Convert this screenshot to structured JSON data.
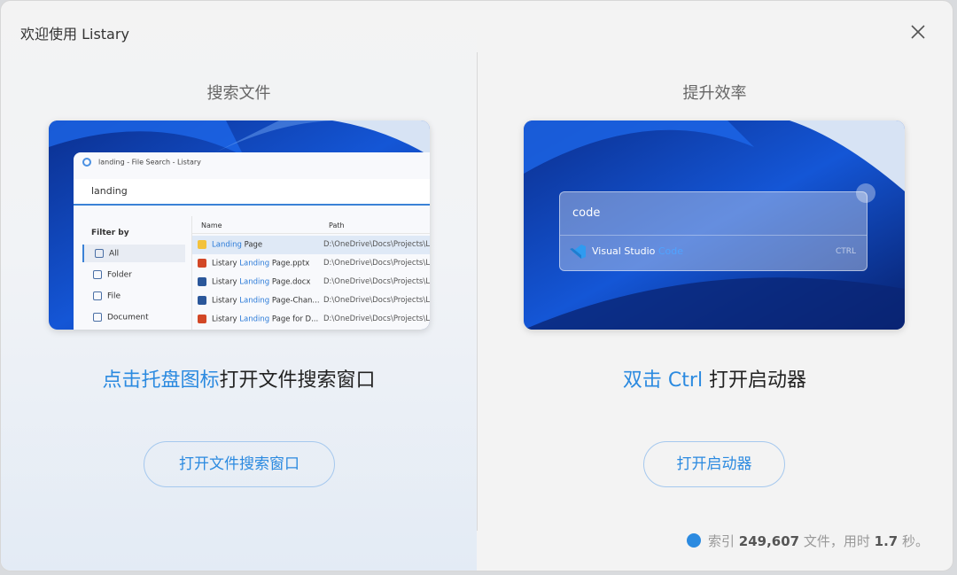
{
  "window": {
    "title": "欢迎使用 Listary"
  },
  "colors": {
    "accent": "#2b8ae0",
    "wallpaper": "#0a3aa8"
  },
  "left": {
    "heading": "搜索文件",
    "caption_highlight": "点击托盘图标",
    "caption_rest": "打开文件搜索窗口",
    "button_label": "打开文件搜索窗口",
    "preview": {
      "window_title": "landing - File Search - Listary",
      "search_value": "landing",
      "filter_label": "Filter by",
      "filters": [
        "All",
        "Folder",
        "File",
        "Document"
      ],
      "columns": [
        "Name",
        "Path"
      ],
      "rows": [
        {
          "pre": "",
          "hl": "Landing",
          "post": " Page",
          "path": "D:\\OneDrive\\Docs\\Projects\\Lista",
          "icon": "folder-icon"
        },
        {
          "pre": "Listary ",
          "hl": "Landing",
          "post": " Page.pptx",
          "path": "D:\\OneDrive\\Docs\\Projects\\Lista",
          "icon": "pptx-icon"
        },
        {
          "pre": "Listary ",
          "hl": "Landing",
          "post": " Page.docx",
          "path": "D:\\OneDrive\\Docs\\Projects\\Lista",
          "icon": "docx-icon"
        },
        {
          "pre": "Listary ",
          "hl": "Landing",
          "post": " Page-Chan...",
          "path": "D:\\OneDrive\\Docs\\Projects\\Lista",
          "icon": "docx-icon"
        },
        {
          "pre": "Listary ",
          "hl": "Landing",
          "post": " Page for D...",
          "path": "D:\\OneDrive\\Docs\\Projects\\Lista",
          "icon": "pptx-icon"
        }
      ]
    }
  },
  "right": {
    "heading": "提升效率",
    "caption_highlight": "双击 Ctrl",
    "caption_rest": " 打开启动器",
    "button_label": "打开启动器",
    "preview": {
      "query": "code",
      "result_pre": "Visual Studio ",
      "result_hl": "Code",
      "hint": "CTRL"
    }
  },
  "status": {
    "prefix": "索引 ",
    "count": "249,607",
    "mid": " 文件，用时 ",
    "seconds": "1.7",
    "suffix": " 秒。"
  }
}
